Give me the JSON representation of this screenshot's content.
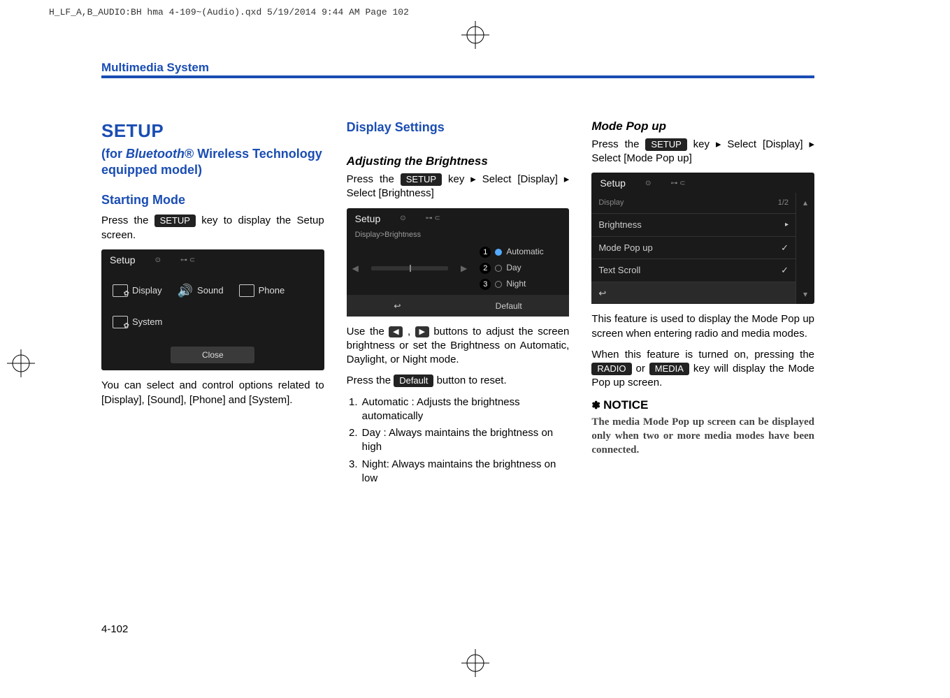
{
  "header": {
    "file_info": "H_LF_A,B_AUDIO:BH hma 4-109~(Audio).qxd  5/19/2014  9:44 AM  Page 102",
    "section": "Multimedia System"
  },
  "col1": {
    "title": "SETUP",
    "subtitle_prefix": "(for ",
    "subtitle_brand": "Bluetooth",
    "subtitle_reg": "®",
    "subtitle_rest": " Wireless Technology equipped model)",
    "h3": "Starting Mode",
    "p1a": "Press the ",
    "key1": "SETUP",
    "p1b": " key to display the Setup screen.",
    "ss": {
      "title": "Setup",
      "icons": [
        "Display",
        "Sound",
        "Phone",
        "System"
      ],
      "close": "Close"
    },
    "p2": "You can select and control options related to [Display], [Sound], [Phone] and [System]."
  },
  "col2": {
    "h3": "Display Settings",
    "h4": "Adjusting the Brightness",
    "p1a": "Press the ",
    "key1": "SETUP",
    "p1b": " key ▸ Select [Display] ▸ Select [Brightness]",
    "ss": {
      "title": "Setup",
      "crumb": "Display>Brightness",
      "opts": [
        "Automatic",
        "Day",
        "Night"
      ],
      "back": "↩",
      "default": "Default"
    },
    "p2a": "Use the ",
    "p2b": " , ",
    "p2c": " buttons to adjust the screen brightness or set the Brightness on Automatic, Daylight, or Night mode.",
    "p3a": "Press the ",
    "key_default": "Default",
    "p3b": " button to reset.",
    "list": [
      "Automatic : Adjusts the brightness automatically",
      "Day : Always maintains the brightness on high",
      "Night: Always maintains the brightness on low"
    ]
  },
  "col3": {
    "h4": "Mode Pop up",
    "p1a": "Press the ",
    "key1": "SETUP",
    "p1b": " key ▸ Select [Display] ▸ Select [Mode Pop up]",
    "ss": {
      "title": "Setup",
      "crumb": "Display",
      "page": "1/2",
      "rows": [
        {
          "label": "Brightness",
          "mark": "▸"
        },
        {
          "label": "Mode Pop up",
          "mark": "✓"
        },
        {
          "label": "Text Scroll",
          "mark": "✓"
        }
      ],
      "back": "↩"
    },
    "p2": "This feature is used to display the Mode Pop up screen when entering radio and media modes.",
    "p3a": "When this feature is turned on, pressing the ",
    "key_radio": "RADIO",
    "p3b": " or ",
    "key_media": "MEDIA",
    "p3c": " key will display the Mode Pop up screen.",
    "notice_title": "NOTICE",
    "notice_body": "The media Mode Pop up screen can be displayed only when two or more media modes have been connected."
  },
  "page_number": "4-102"
}
